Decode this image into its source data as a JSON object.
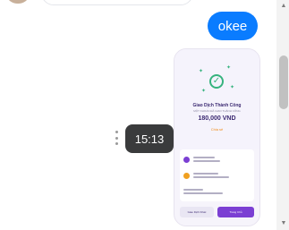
{
  "messages": {
    "outgoing_text": "okee",
    "hover_timestamp": "15:13"
  },
  "image_receipt": {
    "title": "Giao Dịch Thành Công",
    "subtitle": "MỘT KHOẢN ĐÃ GIAO THÀNH CÔNG",
    "amount": "180,000 VND",
    "share_label": "Chia sẻ",
    "left_button": "Giao Dịch Khác",
    "right_button": "Trang Chủ"
  },
  "colors": {
    "bubble_blue": "#0a7cff",
    "tooltip_bg": "#3a3b3c",
    "success_green": "#36b37e",
    "brand_purple": "#7b3fd3"
  },
  "icons": {
    "more": "more-options-icon",
    "check": "check-circle-icon"
  }
}
